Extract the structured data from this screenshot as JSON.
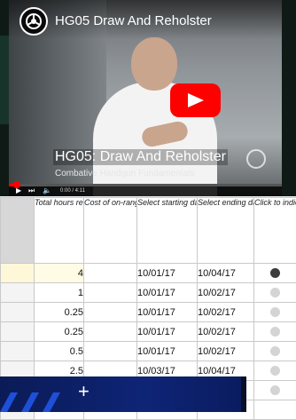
{
  "video": {
    "title": "HG05 Draw And Reholster",
    "overlay_title": "HG05: Draw And Reholster",
    "overlay_subtitle": "Combative Handgun Fundamentals",
    "time": "0:00 / 4:11",
    "progress": 0.03,
    "brand_color": "#ff0000"
  },
  "table": {
    "headers": [
      "",
      "Total hours required to complete activity.",
      "Cost of on-range training.",
      "Select starting date of activity.",
      "Select ending date of activity.",
      "Click to indicate comple-tion level."
    ],
    "rows": [
      {
        "hours": "4",
        "cost": "",
        "start": "10/01/17",
        "end": "10/04/17",
        "complete": true,
        "highlight": true
      },
      {
        "hours": "1",
        "cost": "",
        "start": "10/01/17",
        "end": "10/02/17",
        "complete": false,
        "highlight": false
      },
      {
        "hours": "0.25",
        "cost": "",
        "start": "10/01/17",
        "end": "10/02/17",
        "complete": false,
        "highlight": false
      },
      {
        "hours": "0.25",
        "cost": "",
        "start": "10/01/17",
        "end": "10/02/17",
        "complete": false,
        "highlight": false
      },
      {
        "hours": "0.5",
        "cost": "",
        "start": "10/01/17",
        "end": "10/02/17",
        "complete": false,
        "highlight": false
      },
      {
        "hours": "2.5",
        "cost": "",
        "start": "10/03/17",
        "end": "10/04/17",
        "complete": false,
        "highlight": false
      },
      {
        "hours": "",
        "cost": "",
        "start": "",
        "end": "",
        "complete": false,
        "highlight": false
      },
      {
        "hours": "",
        "cost": "",
        "start": "",
        "end": "",
        "complete": false,
        "highlight": false
      }
    ],
    "colors": {
      "complete": "#3d3d3d",
      "incomplete": "#d4d4d4",
      "highlight": "#fff8d8"
    }
  }
}
